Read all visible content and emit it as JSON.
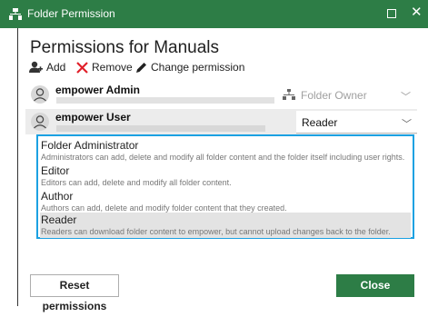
{
  "window": {
    "title": "Folder Permission",
    "app_icon": "network-folder-icon",
    "maximize_icon": "maximize-icon",
    "close_icon": "close-icon",
    "close_glyph": "✕",
    "accent": "#2d7d46"
  },
  "heading": "Permissions for Manuals",
  "toolbar": {
    "add_label": "Add",
    "add_icon": "add-user-icon",
    "remove_label": "Remove",
    "remove_icon": "remove-x-icon",
    "change_label": "Change permission",
    "change_icon": "pencil-icon"
  },
  "users": [
    {
      "name": "empower Admin",
      "role": "Folder Owner",
      "role_icon": "network-icon",
      "role_enabled": false
    },
    {
      "name": "empower User",
      "role": "Reader",
      "role_enabled": true,
      "selected": true
    }
  ],
  "dropdown": {
    "options": [
      {
        "name": "Folder Administrator",
        "description": "Administrators can add, delete and modify all folder content and the folder itself including user rights."
      },
      {
        "name": "Editor",
        "description": "Editors can add, delete and modify all folder content."
      },
      {
        "name": "Author",
        "description": "Authors can add, delete and modify folder content that they created."
      },
      {
        "name": "Reader",
        "description": "Readers can download folder content to empower, but cannot upload changes back to the folder.",
        "selected": true
      }
    ],
    "border_color": "#1ba1e2"
  },
  "footer": {
    "reset_label": "Reset permissions",
    "close_label": "Close"
  }
}
